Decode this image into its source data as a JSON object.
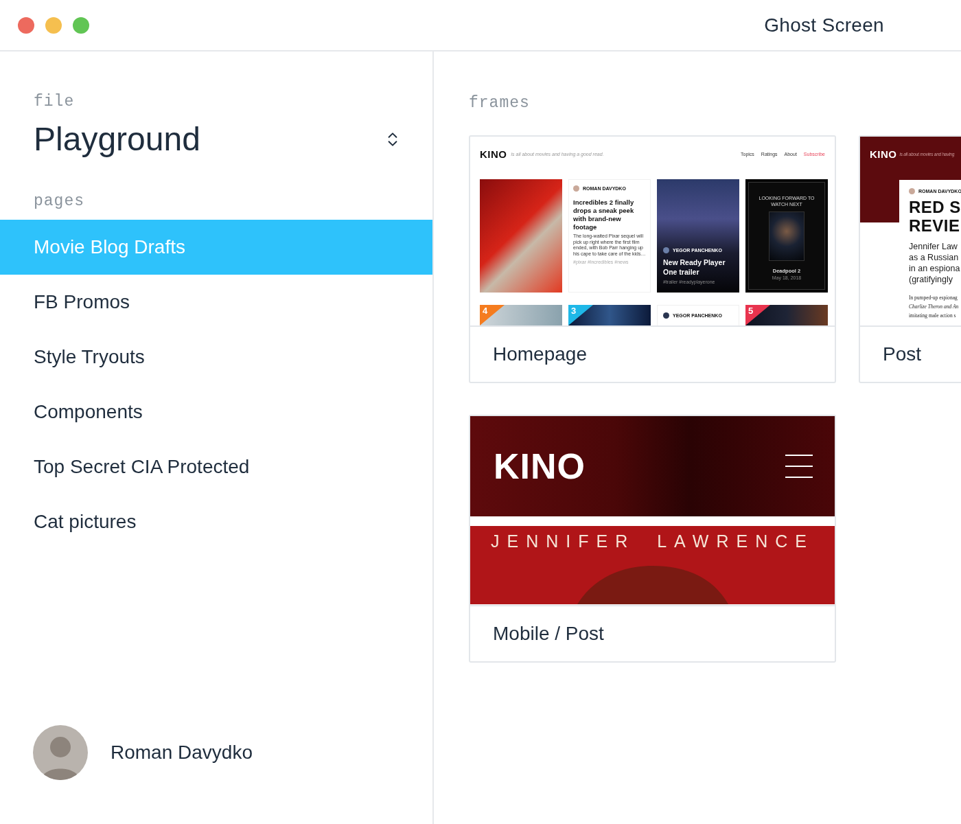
{
  "window": {
    "title": "Ghost Screen"
  },
  "sidebar": {
    "file_label": "file",
    "file_name": "Playground",
    "pages_label": "pages",
    "pages": [
      {
        "label": "Movie Blog Drafts",
        "selected": true
      },
      {
        "label": "FB Promos",
        "selected": false
      },
      {
        "label": "Style Tryouts",
        "selected": false
      },
      {
        "label": "Components",
        "selected": false
      },
      {
        "label": "Top Secret CIA Protected",
        "selected": false
      },
      {
        "label": "Cat pictures",
        "selected": false
      }
    ],
    "user": {
      "name": "Roman Davydko"
    }
  },
  "frames_label": "frames",
  "frames": [
    {
      "kind": "homepage",
      "label": "Homepage",
      "preview": {
        "logo": "KINO",
        "tagline": "is all about movies and having a good read.",
        "nav": [
          {
            "label": "Topics",
            "kind": "link"
          },
          {
            "label": "Ratings",
            "kind": "link"
          },
          {
            "label": "About",
            "kind": "link"
          },
          {
            "label": "Subscribe",
            "kind": "cta"
          }
        ],
        "article": {
          "author": "ROMAN DAVYDKO",
          "title": "Incredibles 2 finally drops a sneak peek with brand-new footage",
          "excerpt": "The long-waited Pixar sequel will pick up right where the first film ended, with Bob Parr hanging up his cape to take care of the kids…",
          "tags": "#pixar #incredibles #news"
        },
        "feature": {
          "author": "YEGOR PANCHENKO",
          "title": "New Ready Player One trailer",
          "tags": "#trailer #readyplayerone"
        },
        "upcoming": {
          "heading": "LOOKING FORWARD TO WATCH NEXT",
          "title": "Deadpool 2",
          "date": "May 18, 2018"
        },
        "ranks": [
          {
            "number": "4",
            "color": "#f57c1f"
          },
          {
            "number": "3",
            "color": "#1fb8e8"
          },
          {
            "number": "5",
            "color": "#e8344e"
          }
        ],
        "second_author": "YEGOR PANCHENKO"
      }
    },
    {
      "kind": "post",
      "label": "Post",
      "preview": {
        "logo": "KINO",
        "tagline": "is all about movies and having",
        "author": "ROMAN DAVYDKO",
        "title_lines": [
          "RED S",
          "REVIE"
        ],
        "lead_lines": [
          "Jennifer Law",
          "as a Russian",
          "in an espiona",
          "(gratifyingly"
        ],
        "body_lines": [
          "In pumped-up espionag",
          "Charlize Theron and An",
          "imitating male action s"
        ]
      }
    },
    {
      "kind": "mobile",
      "label": "Mobile / Post",
      "preview": {
        "logo": "KINO",
        "headline": "JENNIFER LAWRENCE"
      }
    }
  ]
}
